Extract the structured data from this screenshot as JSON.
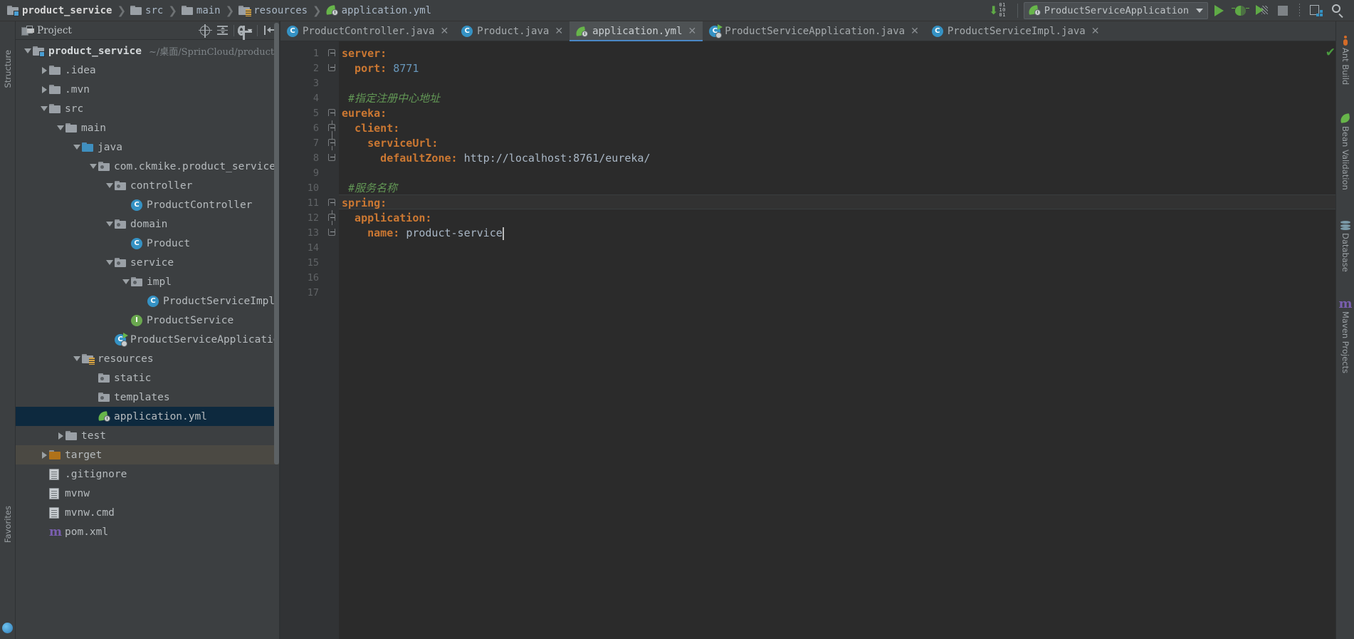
{
  "breadcrumbs": [
    {
      "label": "product_service",
      "icon": "module-folder-icon",
      "bold": true
    },
    {
      "label": "src",
      "icon": "folder-icon",
      "bold": false
    },
    {
      "label": "main",
      "icon": "folder-icon",
      "bold": false
    },
    {
      "label": "resources",
      "icon": "resources-folder-icon",
      "bold": false
    },
    {
      "label": "application.yml",
      "icon": "spring-yaml-icon",
      "bold": false
    }
  ],
  "toolbar": {
    "run_config_name": "ProductServiceApplication",
    "run_label": "Run",
    "debug_label": "Debug",
    "coverage_label": "Run with Coverage",
    "stop_label": "Stop",
    "layout_label": "Restore Layout",
    "search_label": "Search Everywhere",
    "binary_label": "Update Project"
  },
  "left_strip": {
    "items": [
      {
        "label": "Structure"
      },
      {
        "label": "Favorites"
      }
    ]
  },
  "project_panel": {
    "title": "Project",
    "actions": [
      {
        "name": "locate-icon",
        "label": "Select Opened File"
      },
      {
        "name": "collapse-all-icon",
        "label": "Collapse All"
      },
      {
        "name": "settings-icon",
        "label": "Settings"
      },
      {
        "name": "hide-icon",
        "label": "Hide"
      }
    ],
    "tree": [
      {
        "label": "product_service",
        "path": "~/桌面/SprinCloud/product_s",
        "depth": 0,
        "arrow": "down",
        "icon": "module-folder-icon",
        "bold": true,
        "state": "normal"
      },
      {
        "label": ".idea",
        "path": "",
        "depth": 1,
        "arrow": "right",
        "icon": "folder-icon",
        "bold": false,
        "state": "normal"
      },
      {
        "label": ".mvn",
        "path": "",
        "depth": 1,
        "arrow": "right",
        "icon": "folder-icon",
        "bold": false,
        "state": "normal"
      },
      {
        "label": "src",
        "path": "",
        "depth": 1,
        "arrow": "down",
        "icon": "folder-icon",
        "bold": false,
        "state": "normal"
      },
      {
        "label": "main",
        "path": "",
        "depth": 2,
        "arrow": "down",
        "icon": "folder-icon",
        "bold": false,
        "state": "normal"
      },
      {
        "label": "java",
        "path": "",
        "depth": 3,
        "arrow": "down",
        "icon": "source-folder-icon",
        "bold": false,
        "state": "normal"
      },
      {
        "label": "com.ckmike.product_service",
        "path": "",
        "depth": 4,
        "arrow": "down",
        "icon": "package-icon",
        "bold": false,
        "state": "normal"
      },
      {
        "label": "controller",
        "path": "",
        "depth": 5,
        "arrow": "down",
        "icon": "package-icon",
        "bold": false,
        "state": "normal"
      },
      {
        "label": "ProductController",
        "path": "",
        "depth": 6,
        "arrow": "none",
        "icon": "java-class-icon",
        "bold": false,
        "state": "normal"
      },
      {
        "label": "domain",
        "path": "",
        "depth": 5,
        "arrow": "down",
        "icon": "package-icon",
        "bold": false,
        "state": "normal"
      },
      {
        "label": "Product",
        "path": "",
        "depth": 6,
        "arrow": "none",
        "icon": "java-class-icon",
        "bold": false,
        "state": "normal"
      },
      {
        "label": "service",
        "path": "",
        "depth": 5,
        "arrow": "down",
        "icon": "package-icon",
        "bold": false,
        "state": "normal"
      },
      {
        "label": "impl",
        "path": "",
        "depth": 6,
        "arrow": "down",
        "icon": "package-icon",
        "bold": false,
        "state": "normal"
      },
      {
        "label": "ProductServiceImpl",
        "path": "",
        "depth": 7,
        "arrow": "none",
        "icon": "java-class-icon",
        "bold": false,
        "state": "normal"
      },
      {
        "label": "ProductService",
        "path": "",
        "depth": 6,
        "arrow": "none",
        "icon": "java-interface-icon",
        "bold": false,
        "state": "normal"
      },
      {
        "label": "ProductServiceApplication",
        "path": "",
        "depth": 5,
        "arrow": "none",
        "icon": "spring-boot-class-icon",
        "bold": false,
        "state": "normal"
      },
      {
        "label": "resources",
        "path": "",
        "depth": 3,
        "arrow": "down",
        "icon": "resources-folder-icon",
        "bold": false,
        "state": "normal"
      },
      {
        "label": "static",
        "path": "",
        "depth": 4,
        "arrow": "none",
        "icon": "package-icon",
        "bold": false,
        "state": "normal"
      },
      {
        "label": "templates",
        "path": "",
        "depth": 4,
        "arrow": "none",
        "icon": "package-icon",
        "bold": false,
        "state": "normal"
      },
      {
        "label": "application.yml",
        "path": "",
        "depth": 4,
        "arrow": "none",
        "icon": "spring-yaml-icon",
        "bold": false,
        "state": "selected"
      },
      {
        "label": "test",
        "path": "",
        "depth": 2,
        "arrow": "right",
        "icon": "folder-icon",
        "bold": false,
        "state": "normal"
      },
      {
        "label": "target",
        "path": "",
        "depth": 1,
        "arrow": "right",
        "icon": "target-folder-icon",
        "bold": false,
        "state": "excluded"
      },
      {
        "label": ".gitignore",
        "path": "",
        "depth": 1,
        "arrow": "none",
        "icon": "text-file-icon",
        "bold": false,
        "state": "normal"
      },
      {
        "label": "mvnw",
        "path": "",
        "depth": 1,
        "arrow": "none",
        "icon": "text-file-icon",
        "bold": false,
        "state": "normal"
      },
      {
        "label": "mvnw.cmd",
        "path": "",
        "depth": 1,
        "arrow": "none",
        "icon": "text-file-icon",
        "bold": false,
        "state": "normal"
      },
      {
        "label": "pom.xml",
        "path": "",
        "depth": 1,
        "arrow": "none",
        "icon": "maven-pom-icon",
        "bold": false,
        "state": "normal"
      }
    ]
  },
  "editor": {
    "tabs": [
      {
        "label": "ProductController.java",
        "icon": "java-class-icon",
        "active": false
      },
      {
        "label": "Product.java",
        "icon": "java-class-icon",
        "active": false
      },
      {
        "label": "application.yml",
        "icon": "spring-yaml-icon",
        "active": true
      },
      {
        "label": "ProductServiceApplication.java",
        "icon": "spring-boot-class-icon",
        "active": false
      },
      {
        "label": "ProductServiceImpl.java",
        "icon": "java-class-icon",
        "active": false
      }
    ],
    "close_glyph": "✕",
    "filename": "application.yml",
    "inspection_status": "✔",
    "code_lines": [
      {
        "num": "1",
        "fold": "start",
        "tokens": [
          {
            "t": "server:",
            "c": "k"
          }
        ]
      },
      {
        "num": "2",
        "fold": "end",
        "tokens": [
          {
            "t": "  port: ",
            "c": "k"
          },
          {
            "t": "8771",
            "c": "v"
          }
        ]
      },
      {
        "num": "3",
        "fold": "none",
        "tokens": []
      },
      {
        "num": "4",
        "fold": "none",
        "tokens": [
          {
            "t": " #指定注册中心地址",
            "c": "cm"
          }
        ]
      },
      {
        "num": "5",
        "fold": "start",
        "tokens": [
          {
            "t": "eureka:",
            "c": "k"
          }
        ]
      },
      {
        "num": "6",
        "fold": "mid",
        "tokens": [
          {
            "t": "  client:",
            "c": "k"
          }
        ]
      },
      {
        "num": "7",
        "fold": "mid",
        "tokens": [
          {
            "t": "    serviceUrl:",
            "c": "k"
          }
        ]
      },
      {
        "num": "8",
        "fold": "end",
        "tokens": [
          {
            "t": "      defaultZone: ",
            "c": "k"
          },
          {
            "t": "http://localhost:8761/eureka/",
            "c": "plain"
          }
        ]
      },
      {
        "num": "9",
        "fold": "none",
        "tokens": []
      },
      {
        "num": "10",
        "fold": "none",
        "tokens": [
          {
            "t": " #服务名称",
            "c": "cm"
          }
        ]
      },
      {
        "num": "11",
        "fold": "start",
        "tokens": [
          {
            "t": "spring:",
            "c": "k"
          }
        ]
      },
      {
        "num": "12",
        "fold": "mid",
        "tokens": [
          {
            "t": "  application:",
            "c": "k"
          }
        ]
      },
      {
        "num": "13",
        "fold": "end",
        "tokens": [
          {
            "t": "    name: ",
            "c": "k"
          },
          {
            "t": "product-service",
            "c": "plain"
          }
        ]
      },
      {
        "num": "14",
        "fold": "none",
        "tokens": []
      },
      {
        "num": "15",
        "fold": "none",
        "tokens": []
      },
      {
        "num": "16",
        "fold": "none",
        "tokens": []
      },
      {
        "num": "17",
        "fold": "none",
        "tokens": []
      }
    ]
  },
  "right_strip": {
    "items": [
      {
        "label": "Ant Build",
        "icon": "ant-icon"
      },
      {
        "label": "Bean Validation",
        "icon": "bean-icon"
      },
      {
        "label": "Database",
        "icon": "database-icon"
      },
      {
        "label": "Maven Projects",
        "icon": "maven-icon"
      }
    ]
  },
  "colors": {
    "background": "#3c3f41",
    "editor_bg": "#2b2b2b",
    "accent_blue": "#4a88c7",
    "selection": "#0d293e",
    "keyword": "#cc7832",
    "number": "#6897bb",
    "comment": "#629755",
    "text": "#a9b7c6",
    "spring_green": "#67b54a"
  }
}
